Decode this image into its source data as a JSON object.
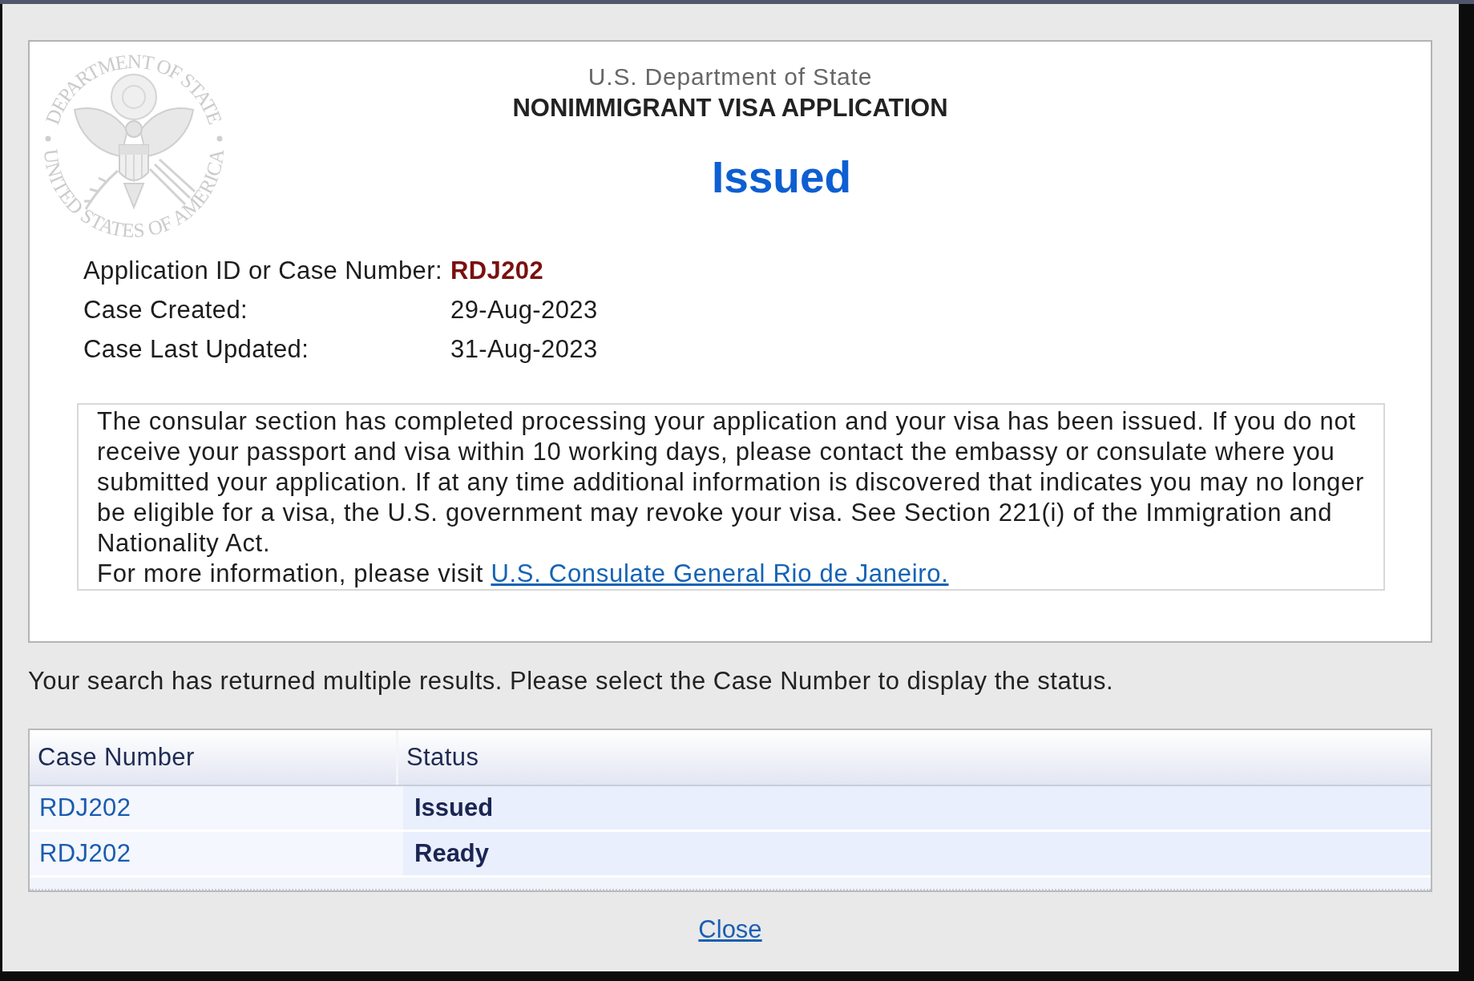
{
  "seal": {
    "top_text": "DEPARTMENT OF STATE",
    "bottom_text": "UNITED STATES OF AMERICA"
  },
  "header": {
    "agency": "U.S. Department of State",
    "form_title": "NONIMMIGRANT VISA APPLICATION"
  },
  "status_heading": "Issued",
  "details": [
    {
      "label": "Application ID or Case Number:",
      "value": "RDJ202",
      "kind": "case_number"
    },
    {
      "label": "Case Created:",
      "value": "29-Aug-2023",
      "kind": "date"
    },
    {
      "label": "Case Last Updated:",
      "value": "31-Aug-2023",
      "kind": "date"
    }
  ],
  "message": {
    "text": "The consular section has completed processing your application and your visa has been issued. If you do not receive your passport and visa within 10 working days, please contact the embassy or consulate where you submitted your application. If at any time additional information is discovered that indicates you may no longer be eligible for a visa, the U.S. government may revoke your visa. See Section 221(i) of the Immigration and Nationality Act.",
    "more_info_prefix": "For more information, please visit",
    "link": "U.S. Consulate General Rio de Janeiro."
  },
  "results_note": "Your search has returned multiple results. Please select the Case Number to display the status.",
  "results_table": {
    "columns": [
      "Case Number",
      "Status"
    ],
    "rows": [
      {
        "case_number": "RDJ202",
        "status": "Issued"
      },
      {
        "case_number": "RDJ202",
        "status": "Ready"
      }
    ]
  },
  "close_link": "Close"
}
